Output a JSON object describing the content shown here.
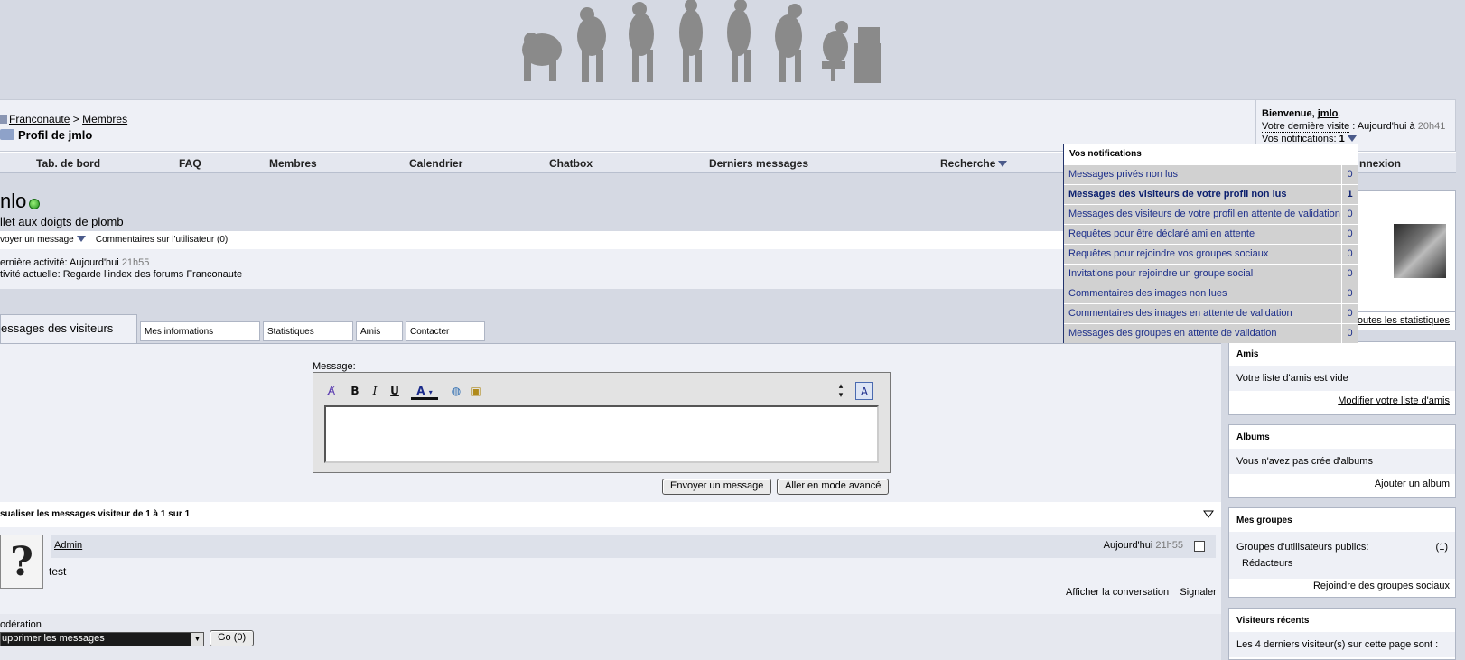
{
  "breadcrumb": {
    "site": "Franconaute",
    "sep": ">",
    "section": "Membres"
  },
  "page_title": "Profil de jmlo",
  "welcome": {
    "greeting": "Bienvenue,",
    "user": "jmlo",
    "last_visit_label": "Votre dernière visite",
    "last_visit_value": ": Aujourd'hui à",
    "last_visit_time": "20h41",
    "notifications_label": "Vos notifications:",
    "notifications_count": "1"
  },
  "nav": [
    "Tab. de bord",
    "FAQ",
    "Membres",
    "Calendrier",
    "Chatbox",
    "Derniers messages",
    "Recherche",
    "nnexion"
  ],
  "profile": {
    "username": "nlo",
    "usertitle": "llet aux doigts de plomb",
    "send_message": "voyer un message",
    "comments": "Commentaires sur l'utilisateur (0)",
    "last_activity_label": "ernière activité:",
    "last_activity_value": "Aujourd'hui",
    "last_activity_time": "21h55",
    "current_activity_label": "tivité actuelle:",
    "current_activity_value": "Regarde l'index des forums Franconaute"
  },
  "tabs": {
    "active": "essages des visiteurs",
    "others": [
      "Mes informations",
      "Statistiques",
      "Amis",
      "Contacter"
    ]
  },
  "editor": {
    "label": "Message:",
    "send_button": "Envoyer un message",
    "advanced_button": "Aller en mode avancé"
  },
  "visitor_messages": {
    "header": "sualiser les messages visiteur de 1 à 1 sur 1",
    "author": "Admin",
    "date": "Aujourd'hui",
    "time": "21h55",
    "body": "test",
    "show_conversation": "Afficher la conversation",
    "report": "Signaler"
  },
  "moderation": {
    "label": "odération",
    "select_value": "upprimer les messages",
    "go_button": "Go (0)"
  },
  "sidebar": {
    "stats_link": "outes les statistiques",
    "friends": {
      "title": "Amis",
      "body": "Votre liste d'amis est vide",
      "link": "Modifier votre liste d'amis"
    },
    "albums": {
      "title": "Albums",
      "body": "Vous n'avez pas crée d'albums",
      "link": "Ajouter un album"
    },
    "groups": {
      "title": "Mes groupes",
      "body": "Groupes d'utilisateurs publics:",
      "count": "(1)",
      "item": "Rédacteurs",
      "link": "Rejoindre des groupes sociaux"
    },
    "visitors": {
      "title": "Visiteurs récents",
      "body": "Les 4 derniers visiteur(s) sur cette page sont :"
    }
  },
  "notifications": {
    "title": "Vos notifications",
    "rows": [
      {
        "label": "Messages privés non lus",
        "count": "0",
        "bold": false
      },
      {
        "label": "Messages des visiteurs de votre profil non lus",
        "count": "1",
        "bold": true
      },
      {
        "label": "Messages des visiteurs de votre profil en attente de validation",
        "count": "0",
        "bold": false
      },
      {
        "label": "Requêtes pour être déclaré ami en attente",
        "count": "0",
        "bold": false
      },
      {
        "label": "Requêtes pour rejoindre vos groupes sociaux",
        "count": "0",
        "bold": false
      },
      {
        "label": "Invitations pour rejoindre un groupe social",
        "count": "0",
        "bold": false
      },
      {
        "label": "Commentaires des images non lues",
        "count": "0",
        "bold": false
      },
      {
        "label": "Commentaires des images en attente de validation",
        "count": "0",
        "bold": false
      },
      {
        "label": "Messages des groupes en attente de validation",
        "count": "0",
        "bold": false
      }
    ]
  },
  "colors": {
    "page_bg": "#d5d9e3",
    "notif_link": "#1d2f8a",
    "online": "#1d8a1a"
  }
}
